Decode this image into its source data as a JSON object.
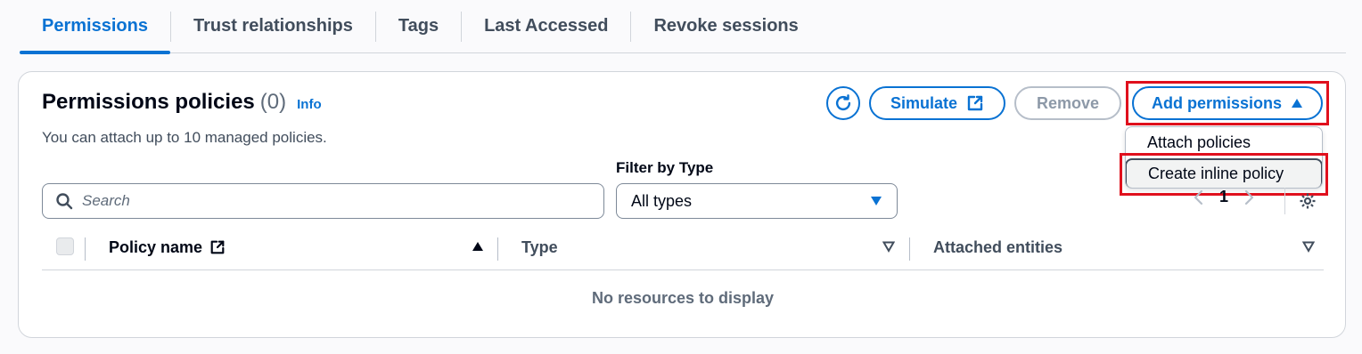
{
  "tabs": [
    {
      "label": "Permissions",
      "active": true
    },
    {
      "label": "Trust relationships",
      "active": false
    },
    {
      "label": "Tags",
      "active": false
    },
    {
      "label": "Last Accessed",
      "active": false
    },
    {
      "label": "Revoke sessions",
      "active": false
    }
  ],
  "panel": {
    "title": "Permissions policies",
    "count": "(0)",
    "info_link": "Info",
    "description": "You can attach up to 10 managed policies."
  },
  "toolbar": {
    "refresh_icon": "refresh-icon",
    "simulate_label": "Simulate",
    "remove_label": "Remove",
    "add_permissions_label": "Add permissions"
  },
  "add_menu": {
    "items": [
      {
        "label": "Attach policies"
      },
      {
        "label": "Create inline policy"
      }
    ]
  },
  "filters": {
    "search_placeholder": "Search",
    "type_label": "Filter by Type",
    "type_value": "All types"
  },
  "pagination": {
    "page": "1"
  },
  "table": {
    "columns": [
      {
        "label": "Policy name"
      },
      {
        "label": "Type"
      },
      {
        "label": "Attached entities"
      }
    ],
    "empty_message": "No resources to display"
  },
  "colors": {
    "accent": "#0972d3",
    "highlight": "#e0101d",
    "disabled": "#8d99a8"
  }
}
